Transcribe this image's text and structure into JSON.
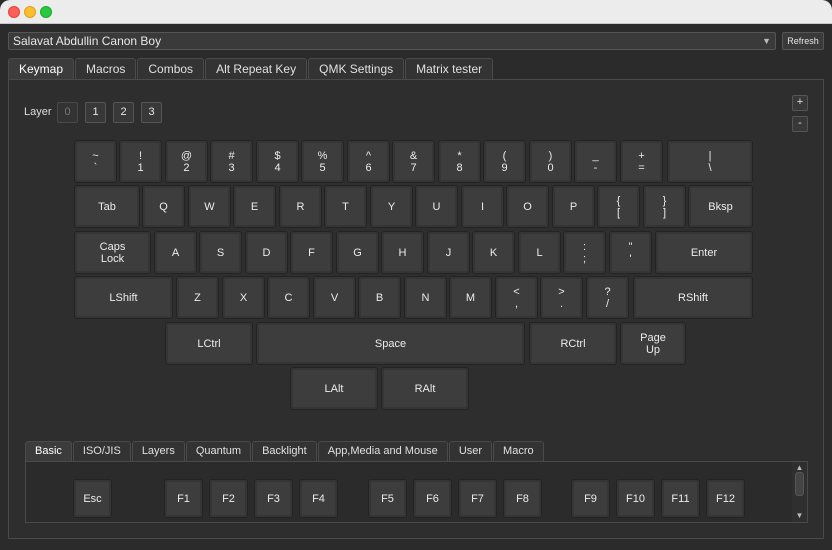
{
  "device": {
    "name": "Salavat Abdullin Canon Boy",
    "refresh_label": "Refresh"
  },
  "tabs": [
    {
      "label": "Keymap",
      "active": true
    },
    {
      "label": "Macros"
    },
    {
      "label": "Combos"
    },
    {
      "label": "Alt Repeat Key"
    },
    {
      "label": "QMK Settings"
    },
    {
      "label": "Matrix tester"
    }
  ],
  "layer": {
    "label": "Layer",
    "buttons": [
      "0",
      "1",
      "2",
      "3"
    ],
    "selected": "0"
  },
  "zoom": {
    "plus": "+",
    "minus": "-"
  },
  "keys": {
    "grave": "~\n`",
    "k1": "!\n1",
    "k2": "@\n2",
    "k3": "#\n3",
    "k4": "$\n4",
    "k5": "%\n5",
    "k6": "^\n6",
    "k7": "&\n7",
    "k8": "*\n8",
    "k9": "(\n9",
    "k0": ")\n0",
    "minus": "_\n-",
    "equal": "+\n=",
    "bslash": "|\n\\",
    "tab": "Tab",
    "q": "Q",
    "w": "W",
    "e": "E",
    "r": "R",
    "t": "T",
    "y": "Y",
    "u": "U",
    "i": "I",
    "o": "O",
    "p": "P",
    "lbracket": "{\n[",
    "rbracket": "}\n]",
    "bksp": "Bksp",
    "caps": "Caps\nLock",
    "a": "A",
    "s": "S",
    "d": "D",
    "f": "F",
    "g": "G",
    "h": "H",
    "j": "J",
    "k": "K",
    "l": "L",
    "semicolon": ":\n;",
    "quote": "\"\n'",
    "enter": "Enter",
    "lshift": "LShift",
    "z": "Z",
    "x": "X",
    "c": "C",
    "v": "V",
    "b": "B",
    "n": "N",
    "m": "M",
    "comma": "<\n,",
    "dot": ">\n.",
    "slash": "?\n/",
    "rshift": "RShift",
    "lctrl": "LCtrl",
    "space": "Space",
    "rctrl": "RCtrl",
    "pgup": "Page\nUp",
    "lalt": "LAlt",
    "ralt": "RAlt"
  },
  "bottom_tabs": [
    {
      "label": "Basic",
      "active": true
    },
    {
      "label": "ISO/JIS"
    },
    {
      "label": "Layers"
    },
    {
      "label": "Quantum"
    },
    {
      "label": "Backlight"
    },
    {
      "label": "App,Media and Mouse"
    },
    {
      "label": "User"
    },
    {
      "label": "Macro"
    }
  ],
  "basic_keys": {
    "esc": "Esc",
    "f1": "F1",
    "f2": "F2",
    "f3": "F3",
    "f4": "F4",
    "f5": "F5",
    "f6": "F6",
    "f7": "F7",
    "f8": "F8",
    "f9": "F9",
    "f10": "F10",
    "f11": "F11",
    "f12": "F12"
  }
}
